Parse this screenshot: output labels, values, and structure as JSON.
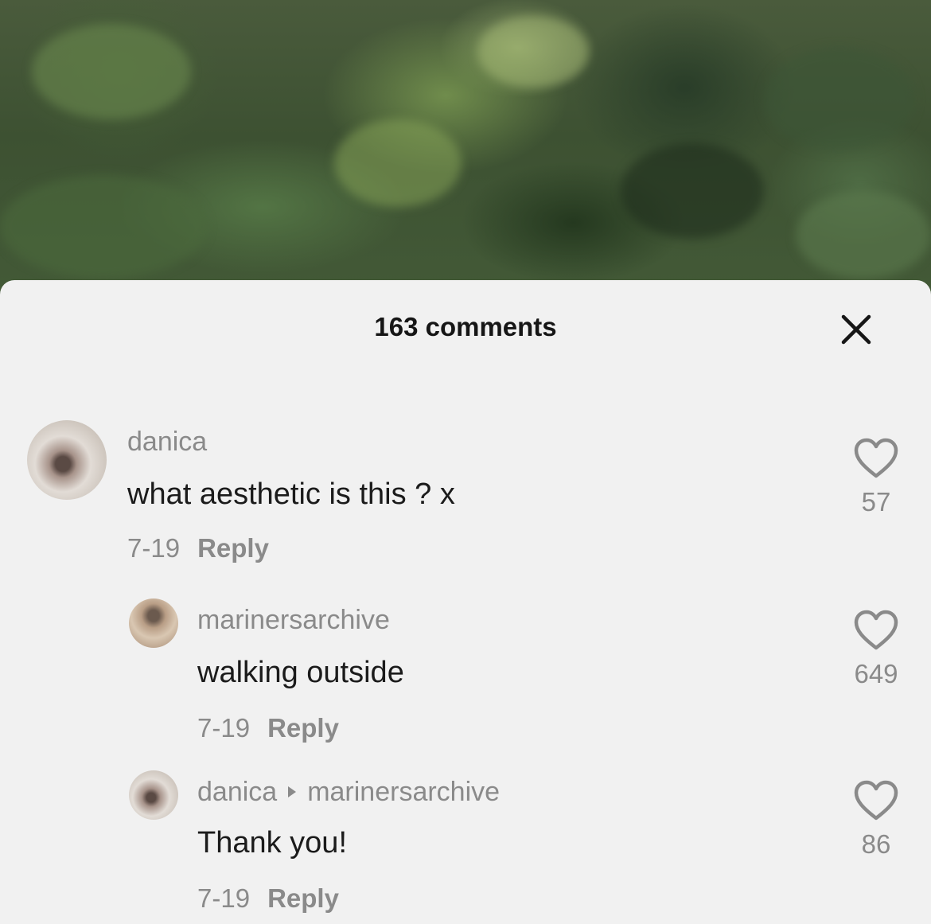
{
  "header": {
    "title": "163 comments",
    "close_icon": "close-icon"
  },
  "comments": [
    {
      "username": "danica",
      "text": "what aesthetic is this ? x",
      "date": "7-19",
      "reply_label": "Reply",
      "likes": "57",
      "like_icon": "heart-outline-icon"
    },
    {
      "username": "marinersarchive",
      "text": "walking outside",
      "date": "7-19",
      "reply_label": "Reply",
      "likes": "649",
      "like_icon": "heart-outline-icon"
    },
    {
      "username": "danica",
      "reply_to": "marinersarchive",
      "text": "Thank you!",
      "date": "7-19",
      "reply_label": "Reply",
      "likes": "86",
      "like_icon": "heart-outline-icon"
    }
  ],
  "colors": {
    "sheet_background": "#f1f1f1",
    "primary_text": "#1b1b1b",
    "secondary_text": "#8a8a8a"
  }
}
